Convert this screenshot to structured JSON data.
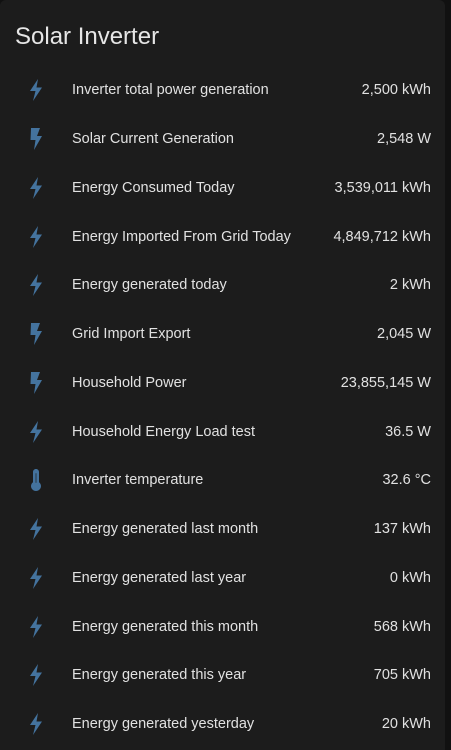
{
  "card": {
    "title": "Solar Inverter"
  },
  "theme": {
    "icon_color": "#44739e",
    "card_bg": "#1c1c1c",
    "page_bg": "#111111",
    "text_color": "#e1e1e1"
  },
  "entities": [
    {
      "icon": "flash-icon",
      "name": "Inverter total power generation",
      "value": "2,500 kWh"
    },
    {
      "icon": "flash-bolt-icon",
      "name": "Solar Current Generation",
      "value": "2,548 W"
    },
    {
      "icon": "flash-icon",
      "name": "Energy Consumed Today",
      "value": "3,539,011 kWh"
    },
    {
      "icon": "flash-icon",
      "name": "Energy Imported From Grid Today",
      "value": "4,849,712 kWh"
    },
    {
      "icon": "flash-icon",
      "name": "Energy generated today",
      "value": "2 kWh"
    },
    {
      "icon": "flash-bolt-icon",
      "name": "Grid Import Export",
      "value": "2,045 W"
    },
    {
      "icon": "flash-bolt-icon",
      "name": "Household Power",
      "value": "23,855,145 W"
    },
    {
      "icon": "flash-icon",
      "name": "Household Energy Load test",
      "value": "36.5 W"
    },
    {
      "icon": "thermometer-icon",
      "name": "Inverter temperature",
      "value": "32.6 °C"
    },
    {
      "icon": "flash-icon",
      "name": "Energy generated last month",
      "value": "137 kWh"
    },
    {
      "icon": "flash-icon",
      "name": "Energy generated last year",
      "value": "0 kWh"
    },
    {
      "icon": "flash-icon",
      "name": "Energy generated this month",
      "value": "568 kWh"
    },
    {
      "icon": "flash-icon",
      "name": "Energy generated this year",
      "value": "705 kWh"
    },
    {
      "icon": "flash-icon",
      "name": "Energy generated yesterday",
      "value": "20 kWh"
    }
  ]
}
